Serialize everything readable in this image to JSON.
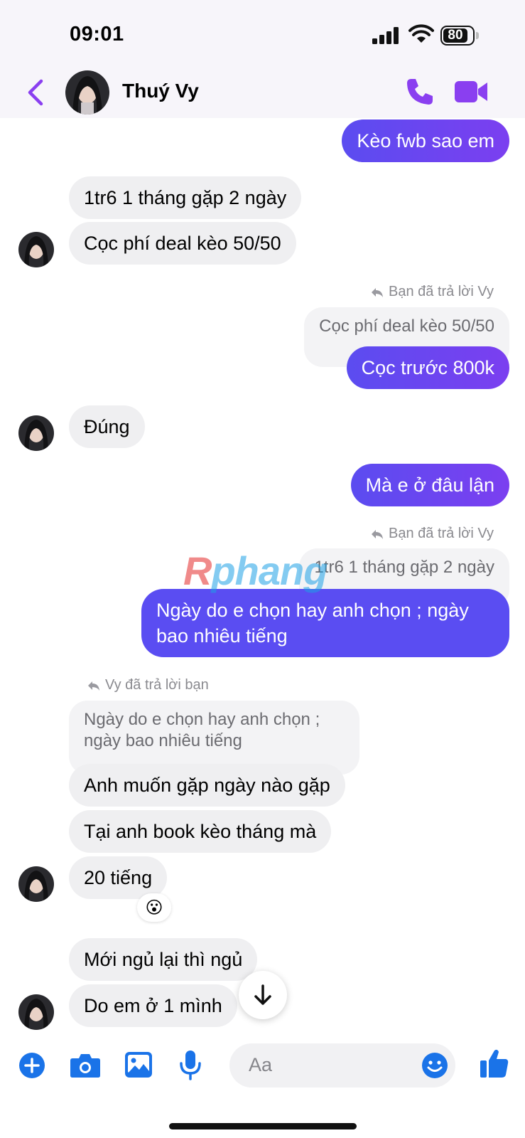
{
  "status_bar": {
    "time": "09:01",
    "battery": "80"
  },
  "header": {
    "contact_name": "Thuý Vy"
  },
  "messages": {
    "m1": "Kèo fwb sao em",
    "m2": "1tr6 1 tháng gặp 2 ngày",
    "m3": "Cọc phí deal kèo 50/50",
    "reply_note_1": "Bạn đã trả lời Vy",
    "quote_1": "Cọc phí deal kèo 50/50",
    "m4": "Cọc trước 800k",
    "m5": "Đúng",
    "m6": "Mà e ở đâu lận",
    "reply_note_2": "Bạn đã trả lời Vy",
    "quote_2": "1tr6 1 tháng gặp 2 ngày",
    "m7_line1": "Ngày do e chọn hay anh chọn ; ngày",
    "m7_line2": "bao nhiêu tiếng",
    "reply_note_3": "Vy đã trả lời bạn",
    "quote_3_line1": "Ngày do e chọn hay anh chọn ;",
    "quote_3_line2": "ngày bao nhiêu tiếng",
    "m8": "Anh muốn gặp ngày nào gặp",
    "m9": "Tại anh book kèo tháng mà",
    "m10": "20 tiếng",
    "reaction": "😮",
    "m11": "Mới ngủ lại thì ngủ",
    "m12": "Do em ở 1 mình"
  },
  "watermark": {
    "r": "R",
    "rest": "phang"
  },
  "composer": {
    "placeholder": "Aa"
  },
  "colors": {
    "accent": "#7b3ff0",
    "outgoing": "#5a4df2",
    "incoming": "#efeff1",
    "tool_blue": "#1a73e8"
  }
}
